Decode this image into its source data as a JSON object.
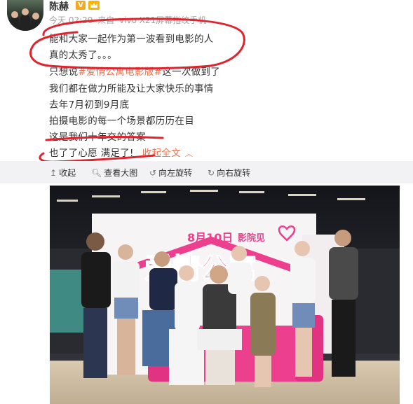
{
  "post": {
    "author": "陈赫",
    "badges": {
      "vip": "V",
      "crown": "crown-icon"
    },
    "meta": {
      "time": "今天 02:20",
      "source_prefix": "来自",
      "source": "vivo X21屏幕指纹手机"
    },
    "lines": [
      {
        "text": "能和大家一起作为第一波看到电影的人"
      },
      {
        "text": "真的太秀了。。。"
      },
      {
        "before": "只想说",
        "topic": "#爱情公寓电影版#",
        "after": "这一次做到了"
      },
      {
        "text": "我们都在做力所能及让大家快乐的事情"
      },
      {
        "text": "去年7月初到9月底"
      },
      {
        "text": "拍摄电影的每一个场景都历历在目"
      },
      {
        "text": "这是我们十年交的答案"
      },
      {
        "text": "也了了心愿 满足了!",
        "link": "收起全文"
      }
    ]
  },
  "toolbar": [
    {
      "label": "收起",
      "icon": "arrow-up-icon"
    },
    {
      "label": "查看大图",
      "icon": "magnifier-icon"
    },
    {
      "label": "向左旋转",
      "icon": "rotate-left-icon"
    },
    {
      "label": "向右旋转",
      "icon": "rotate-right-icon"
    }
  ],
  "photo": {
    "poster_date": "8月10日",
    "poster_tagline": "影院见",
    "poster_title": "爱情公寓"
  },
  "colors": {
    "accent": "#eb7350",
    "ink": "#e0242e",
    "toolbar_bg": "#f2f2f5",
    "poster_pink": "#ec3f8d"
  }
}
